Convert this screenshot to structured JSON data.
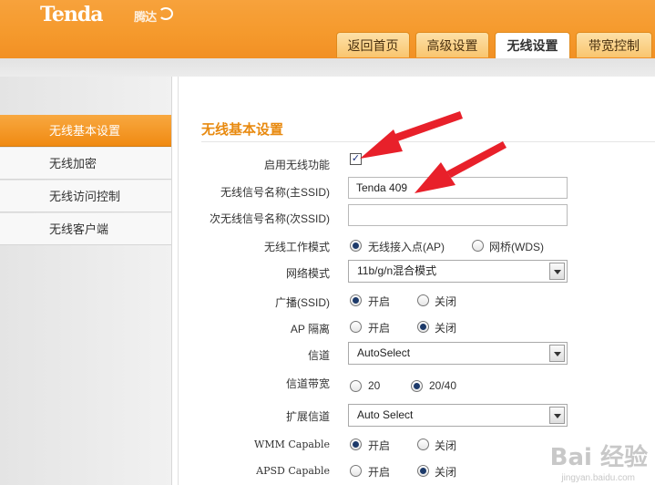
{
  "header": {
    "logo_text": "Tenda",
    "logo_suffix": "腾达",
    "tabs": [
      {
        "label": "返回首页",
        "active": false
      },
      {
        "label": "高级设置",
        "active": false
      },
      {
        "label": "无线设置",
        "active": true
      },
      {
        "label": "带宽控制",
        "active": false
      }
    ]
  },
  "sidebar": {
    "items": [
      {
        "label": "无线基本设置",
        "active": true
      },
      {
        "label": "无线加密",
        "active": false
      },
      {
        "label": "无线访问控制",
        "active": false
      },
      {
        "label": "无线客户端",
        "active": false
      }
    ]
  },
  "main": {
    "title": "无线基本设置",
    "enable_wireless": {
      "label": "启用无线功能",
      "checked": true,
      "check_glyph": "✓"
    },
    "ssid": {
      "label": "无线信号名称(主SSID)",
      "value": "Tenda 409"
    },
    "ssid2": {
      "label": "次无线信号名称(次SSID)",
      "value": ""
    },
    "work_mode": {
      "label": "无线工作模式",
      "options": [
        "无线接入点(AP)",
        "网桥(WDS)"
      ],
      "selected": 0
    },
    "network_mode": {
      "label": "网络模式",
      "value": "11b/g/n混合模式"
    },
    "broadcast": {
      "label": "广播(SSID)",
      "options": [
        "开启",
        "关闭"
      ],
      "selected": 0
    },
    "ap_isolation": {
      "label": "AP 隔离",
      "options": [
        "开启",
        "关闭"
      ],
      "selected": 1
    },
    "channel": {
      "label": "信道",
      "value": "AutoSelect"
    },
    "bandwidth": {
      "label": "信道带宽",
      "options": [
        "20",
        "20/40"
      ],
      "selected": 1
    },
    "ext_channel": {
      "label": "扩展信道",
      "value": "Auto Select"
    },
    "wmm": {
      "label": "WMM Capable",
      "options": [
        "开启",
        "关闭"
      ],
      "selected": 0
    },
    "apsd": {
      "label": "APSD Capable",
      "options": [
        "开启",
        "关闭"
      ],
      "selected": 1
    }
  },
  "watermark": {
    "text": "Bai 经验",
    "url": "jingyan.baidu.com"
  },
  "colors": {
    "accent": "#f29024",
    "arrow": "#e8202a",
    "title": "#e88a10"
  }
}
